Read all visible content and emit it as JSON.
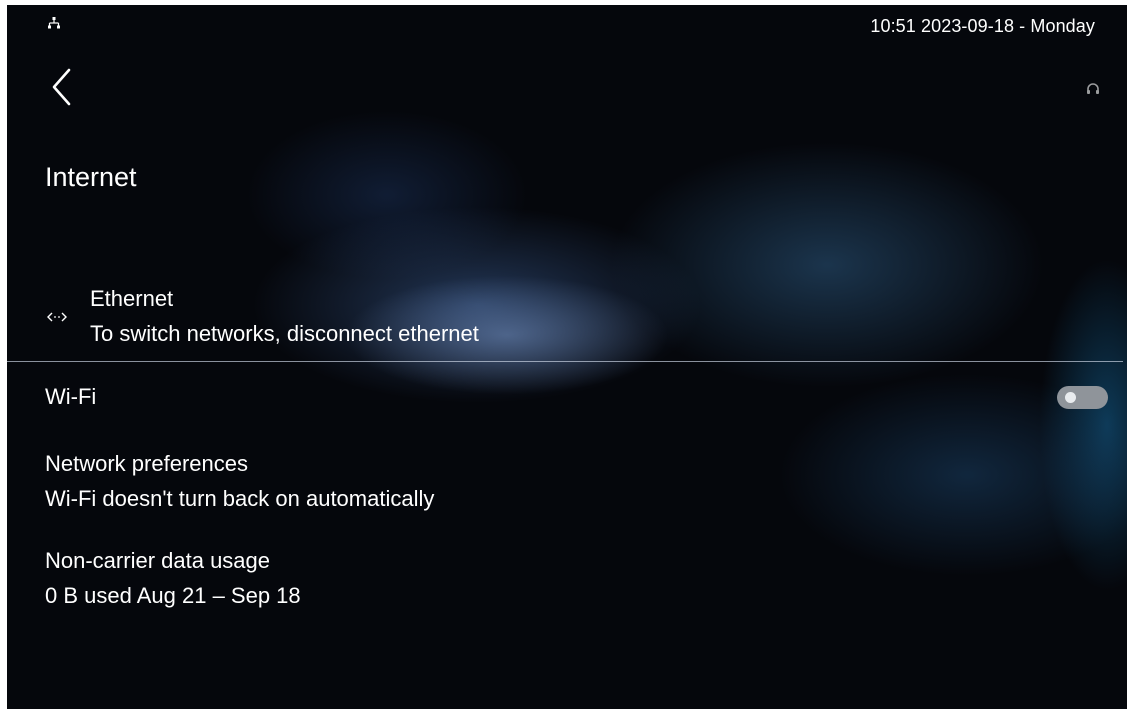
{
  "status_bar": {
    "network_icon": "ethernet-connected-icon",
    "clock": "10:51  2023-09-18 - Monday"
  },
  "toolbar": {
    "back_icon": "chevron-left-icon",
    "right_icon": "headset-icon"
  },
  "page": {
    "title": "Internet"
  },
  "ethernet": {
    "icon": "ethernet-arrows-icon",
    "title": "Ethernet",
    "summary": "To switch networks, disconnect ethernet"
  },
  "wifi": {
    "label": "Wi-Fi",
    "enabled": false
  },
  "items": [
    {
      "title": "Network preferences",
      "summary": "Wi-Fi doesn't turn back on automatically"
    },
    {
      "title": "Non-carrier data usage",
      "summary": "0 B used Aug 21 – Sep 18"
    }
  ],
  "colors": {
    "background": "#05070c",
    "text": "#ffffff",
    "toggle_track_off": "#8f949a",
    "toggle_knob": "#e9ecef"
  }
}
